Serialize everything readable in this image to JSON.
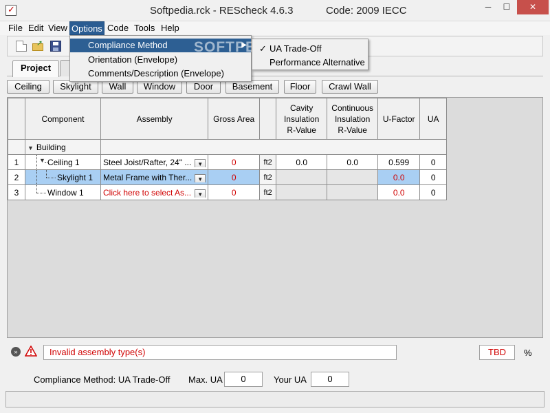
{
  "window": {
    "title_left": "Softpedia.rck - REScheck 4.6.3",
    "title_right": "Code: 2009 IECC",
    "controls": {
      "minimize": "─",
      "maximize": "☐",
      "close": "✕"
    }
  },
  "menubar": {
    "items": [
      "File",
      "Edit",
      "View",
      "Options",
      "Code",
      "Tools",
      "Help"
    ],
    "active": "Options"
  },
  "options_menu": {
    "items": [
      "Compliance Method",
      "Orientation (Envelope)",
      "Comments/Description (Envelope)"
    ],
    "highlighted": "Compliance Method",
    "submenu_arrow": "▶"
  },
  "compliance_submenu": {
    "items": [
      "UA Trade-Off",
      "Performance Alternative"
    ],
    "checked": "UA Trade-Off",
    "check_mark": "✓"
  },
  "watermark": "SOFTPEDIA",
  "tabs": [
    {
      "label": "Project",
      "active": true
    },
    {
      "label": "",
      "active": false
    }
  ],
  "envelope_buttons": [
    "Ceiling",
    "Skylight",
    "Wall",
    "Window",
    "Door",
    "Basement",
    "Floor",
    "Crawl Wall"
  ],
  "grid": {
    "headers": [
      "",
      "Component",
      "Assembly",
      "Gross Area",
      "",
      "Cavity Insulation R-Value",
      "Continuous Insulation R-Value",
      "U-Factor",
      "UA"
    ],
    "group_label": "Building",
    "rows": [
      {
        "n": "1",
        "component": "Ceiling 1",
        "assembly": "Steel Joist/Rafter, 24\" ...",
        "gross_area": "0",
        "unit": "ft2",
        "cavity": "0.0",
        "continuous": "0.0",
        "u_factor": "0.599",
        "ua": "0"
      },
      {
        "n": "2",
        "component": "Skylight 1",
        "assembly": "Metal Frame with Ther...",
        "gross_area": "0",
        "unit": "ft2",
        "cavity": "",
        "continuous": "",
        "u_factor": "0.0",
        "ua": "0"
      },
      {
        "n": "3",
        "component": "Window 1",
        "assembly": "Click here to select As...",
        "gross_area": "0",
        "unit": "ft2",
        "cavity": "",
        "continuous": "",
        "u_factor": "0.0",
        "ua": "0"
      }
    ]
  },
  "status": {
    "message": "Invalid assembly type(s)",
    "result": "TBD",
    "percent_symbol": "%"
  },
  "compliance": {
    "method_label": "Compliance Method: UA Trade-Off",
    "max_ua_label": "Max. UA",
    "max_ua_value": "0",
    "your_ua_label": "Your UA",
    "your_ua_value": "0"
  },
  "colors": {
    "menu_highlight": "#2d5f93",
    "error_text": "#d00000",
    "selection": "#a9cff3",
    "close_button": "#c7504b"
  }
}
